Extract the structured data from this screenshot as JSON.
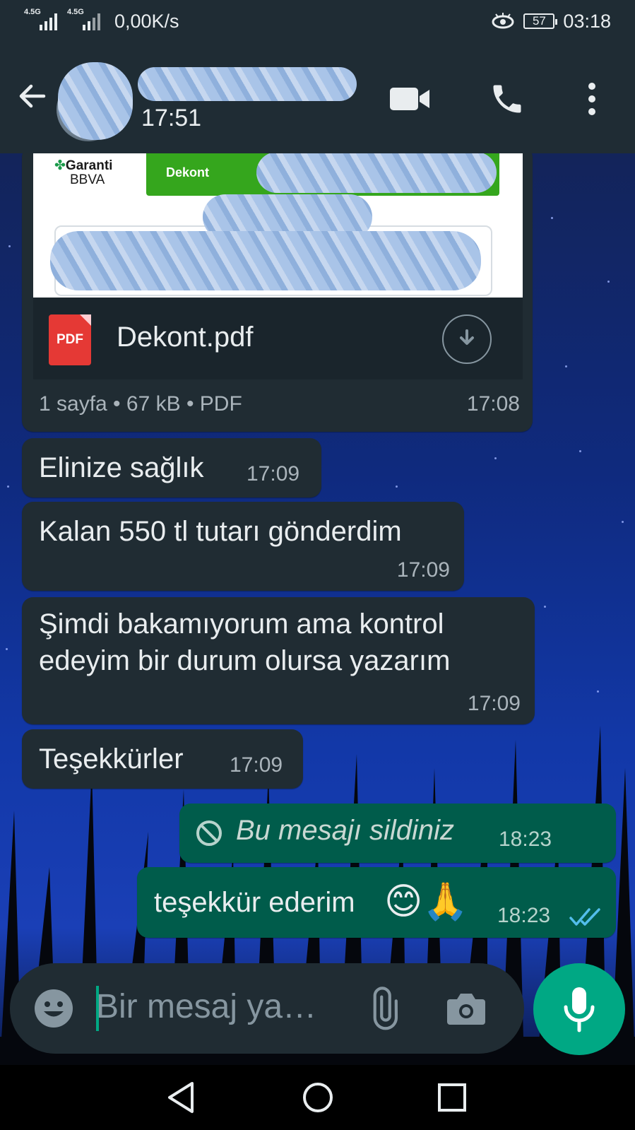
{
  "status_bar": {
    "network1": "4.5G",
    "network2": "4.5G",
    "speed": "0,00K/s",
    "battery": "57",
    "clock": "03:18"
  },
  "header": {
    "contact_time": "17:51",
    "back_icon": "arrow-left-icon",
    "video_icon": "video-camera-icon",
    "call_icon": "phone-icon",
    "menu_icon": "more-vert-icon"
  },
  "document_message": {
    "bank_logo_line1": "Garanti",
    "bank_logo_line2": "BBVA",
    "banner_label": "Dekont",
    "file_type_badge": "PDF",
    "file_name": "Dekont.pdf",
    "meta": "1 sayfa • 67 kB • PDF",
    "time": "17:08"
  },
  "messages": [
    {
      "direction": "in",
      "text": "Elinize sağlık",
      "time": "17:09"
    },
    {
      "direction": "in",
      "text": "Kalan 550 tl tutarı gönderdim",
      "time": "17:09"
    },
    {
      "direction": "in",
      "text": "Şimdi bakamıyorum ama kontrol edeyim bir durum olursa yazarım",
      "time": "17:09"
    },
    {
      "direction": "in",
      "text": "Teşekkürler",
      "time": "17:09"
    },
    {
      "direction": "out",
      "text": "Bu mesajı sildiniz",
      "time": "18:23",
      "deleted": true
    },
    {
      "direction": "out",
      "text": "teşekkür ederim",
      "emoji": "😊🙏",
      "time": "18:23",
      "status": "read"
    }
  ],
  "input": {
    "placeholder": "Bir mesaj ya…",
    "emoji_icon": "emoji-icon",
    "attach_icon": "paperclip-icon",
    "camera_icon": "camera-icon",
    "mic_icon": "microphone-icon"
  },
  "colors": {
    "header_bg": "#1f2c34",
    "incoming_bubble": "#202c33",
    "outgoing_bubble": "#005c4b",
    "accent": "#00a884",
    "read_ticks": "#53bdeb"
  }
}
